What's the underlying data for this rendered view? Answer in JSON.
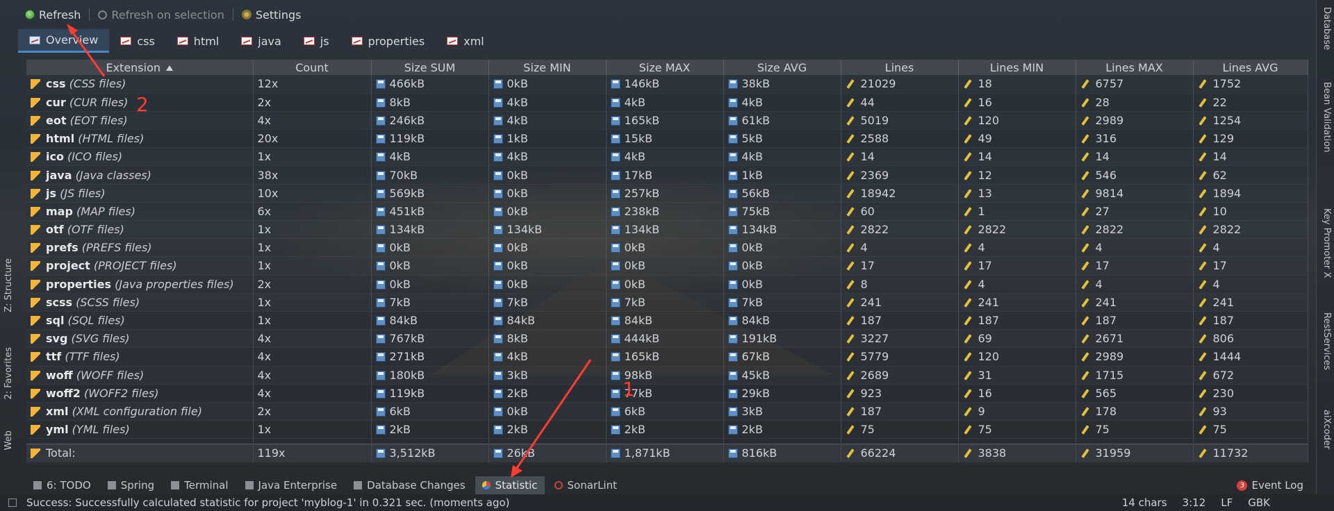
{
  "toolbar": {
    "refresh": "Refresh",
    "refresh_on_selection": "Refresh on selection",
    "settings": "Settings"
  },
  "tabs": [
    "Overview",
    "css",
    "html",
    "java",
    "js",
    "properties",
    "xml"
  ],
  "table": {
    "columns": [
      "Extension",
      "Count",
      "Size SUM",
      "Size MIN",
      "Size MAX",
      "Size AVG",
      "Lines",
      "Lines MIN",
      "Lines MAX",
      "Lines AVG"
    ],
    "rows": [
      {
        "ext": "css",
        "desc": "CSS files",
        "count": "12x",
        "size_sum": "466kB",
        "size_min": "0kB",
        "size_max": "146kB",
        "size_avg": "38kB",
        "lines": "21029",
        "lines_min": "18",
        "lines_max": "6757",
        "lines_avg": "1752"
      },
      {
        "ext": "cur",
        "desc": "CUR files",
        "count": "2x",
        "size_sum": "8kB",
        "size_min": "4kB",
        "size_max": "4kB",
        "size_avg": "4kB",
        "lines": "44",
        "lines_min": "16",
        "lines_max": "28",
        "lines_avg": "22"
      },
      {
        "ext": "eot",
        "desc": "EOT files",
        "count": "4x",
        "size_sum": "246kB",
        "size_min": "4kB",
        "size_max": "165kB",
        "size_avg": "61kB",
        "lines": "5019",
        "lines_min": "120",
        "lines_max": "2989",
        "lines_avg": "1254"
      },
      {
        "ext": "html",
        "desc": "HTML files",
        "count": "20x",
        "size_sum": "119kB",
        "size_min": "1kB",
        "size_max": "15kB",
        "size_avg": "5kB",
        "lines": "2588",
        "lines_min": "49",
        "lines_max": "316",
        "lines_avg": "129"
      },
      {
        "ext": "ico",
        "desc": "ICO files",
        "count": "1x",
        "size_sum": "4kB",
        "size_min": "4kB",
        "size_max": "4kB",
        "size_avg": "4kB",
        "lines": "14",
        "lines_min": "14",
        "lines_max": "14",
        "lines_avg": "14"
      },
      {
        "ext": "java",
        "desc": "Java classes",
        "count": "38x",
        "size_sum": "70kB",
        "size_min": "0kB",
        "size_max": "17kB",
        "size_avg": "1kB",
        "lines": "2369",
        "lines_min": "12",
        "lines_max": "546",
        "lines_avg": "62"
      },
      {
        "ext": "js",
        "desc": "JS files",
        "count": "10x",
        "size_sum": "569kB",
        "size_min": "0kB",
        "size_max": "257kB",
        "size_avg": "56kB",
        "lines": "18942",
        "lines_min": "13",
        "lines_max": "9814",
        "lines_avg": "1894"
      },
      {
        "ext": "map",
        "desc": "MAP files",
        "count": "6x",
        "size_sum": "451kB",
        "size_min": "0kB",
        "size_max": "238kB",
        "size_avg": "75kB",
        "lines": "60",
        "lines_min": "1",
        "lines_max": "27",
        "lines_avg": "10"
      },
      {
        "ext": "otf",
        "desc": "OTF files",
        "count": "1x",
        "size_sum": "134kB",
        "size_min": "134kB",
        "size_max": "134kB",
        "size_avg": "134kB",
        "lines": "2822",
        "lines_min": "2822",
        "lines_max": "2822",
        "lines_avg": "2822"
      },
      {
        "ext": "prefs",
        "desc": "PREFS files",
        "count": "1x",
        "size_sum": "0kB",
        "size_min": "0kB",
        "size_max": "0kB",
        "size_avg": "0kB",
        "lines": "4",
        "lines_min": "4",
        "lines_max": "4",
        "lines_avg": "4"
      },
      {
        "ext": "project",
        "desc": "PROJECT files",
        "count": "1x",
        "size_sum": "0kB",
        "size_min": "0kB",
        "size_max": "0kB",
        "size_avg": "0kB",
        "lines": "17",
        "lines_min": "17",
        "lines_max": "17",
        "lines_avg": "17"
      },
      {
        "ext": "properties",
        "desc": "Java properties files",
        "count": "2x",
        "size_sum": "0kB",
        "size_min": "0kB",
        "size_max": "0kB",
        "size_avg": "0kB",
        "lines": "8",
        "lines_min": "4",
        "lines_max": "4",
        "lines_avg": "4"
      },
      {
        "ext": "scss",
        "desc": "SCSS files",
        "count": "1x",
        "size_sum": "7kB",
        "size_min": "7kB",
        "size_max": "7kB",
        "size_avg": "7kB",
        "lines": "241",
        "lines_min": "241",
        "lines_max": "241",
        "lines_avg": "241"
      },
      {
        "ext": "sql",
        "desc": "SQL files",
        "count": "1x",
        "size_sum": "84kB",
        "size_min": "84kB",
        "size_max": "84kB",
        "size_avg": "84kB",
        "lines": "187",
        "lines_min": "187",
        "lines_max": "187",
        "lines_avg": "187"
      },
      {
        "ext": "svg",
        "desc": "SVG files",
        "count": "4x",
        "size_sum": "767kB",
        "size_min": "8kB",
        "size_max": "444kB",
        "size_avg": "191kB",
        "lines": "3227",
        "lines_min": "69",
        "lines_max": "2671",
        "lines_avg": "806"
      },
      {
        "ext": "ttf",
        "desc": "TTF files",
        "count": "4x",
        "size_sum": "271kB",
        "size_min": "4kB",
        "size_max": "165kB",
        "size_avg": "67kB",
        "lines": "5779",
        "lines_min": "120",
        "lines_max": "2989",
        "lines_avg": "1444"
      },
      {
        "ext": "woff",
        "desc": "WOFF files",
        "count": "4x",
        "size_sum": "180kB",
        "size_min": "3kB",
        "size_max": "98kB",
        "size_avg": "45kB",
        "lines": "2689",
        "lines_min": "31",
        "lines_max": "1715",
        "lines_avg": "672"
      },
      {
        "ext": "woff2",
        "desc": "WOFF2 files",
        "count": "4x",
        "size_sum": "119kB",
        "size_min": "2kB",
        "size_max": "77kB",
        "size_avg": "29kB",
        "lines": "923",
        "lines_min": "16",
        "lines_max": "565",
        "lines_avg": "230"
      },
      {
        "ext": "xml",
        "desc": "XML configuration file",
        "count": "2x",
        "size_sum": "6kB",
        "size_min": "0kB",
        "size_max": "6kB",
        "size_avg": "3kB",
        "lines": "187",
        "lines_min": "9",
        "lines_max": "178",
        "lines_avg": "93"
      },
      {
        "ext": "yml",
        "desc": "YML files",
        "count": "1x",
        "size_sum": "2kB",
        "size_min": "2kB",
        "size_max": "2kB",
        "size_avg": "2kB",
        "lines": "75",
        "lines_min": "75",
        "lines_max": "75",
        "lines_avg": "75"
      }
    ],
    "total": {
      "label": "Total:",
      "count": "119x",
      "size_sum": "3,512kB",
      "size_min": "26kB",
      "size_max": "1,871kB",
      "size_avg": "816kB",
      "lines": "66224",
      "lines_min": "3838",
      "lines_max": "31959",
      "lines_avg": "11732"
    }
  },
  "bottom_tabs": [
    {
      "label": "6: TODO"
    },
    {
      "label": "Spring"
    },
    {
      "label": "Terminal"
    },
    {
      "label": "Java Enterprise"
    },
    {
      "label": "Database Changes"
    },
    {
      "label": "Statistic"
    },
    {
      "label": "SonarLint"
    }
  ],
  "event_log": {
    "label": "Event Log",
    "count": "3"
  },
  "status": {
    "message": "Success: Successfully calculated statistic for project 'myblog-1' in 0.321 sec. (moments ago)",
    "chars": "14 chars",
    "position": "3:12",
    "line_sep": "LF",
    "encoding": "GBK"
  },
  "right_tabs": [
    "Database",
    "Bean Validation",
    "Key Promoter X",
    "RestServices",
    "aiXcoder"
  ],
  "left_tabs": [
    "Z: Structure",
    "2: Favorites",
    "Web"
  ],
  "annotations": [
    "2",
    "1"
  ]
}
